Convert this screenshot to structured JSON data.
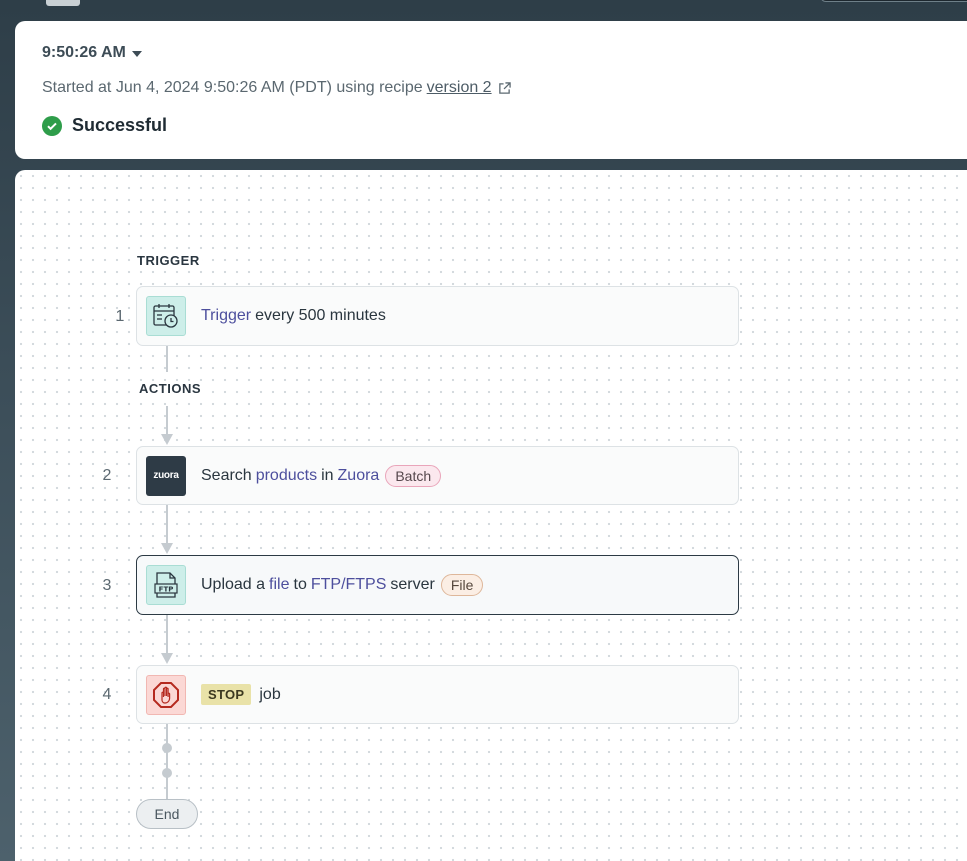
{
  "header": {
    "time": "9:50:26 AM",
    "started_prefix": "Started at Jun 4, 2024 9:50:26 AM (PDT) using recipe",
    "version_link": "version 2",
    "status": "Successful",
    "status_color": "#2e9d4a"
  },
  "flow": {
    "trigger_label": "TRIGGER",
    "actions_label": "ACTIONS",
    "steps": [
      {
        "num": "1",
        "icon": "calendar-clock-icon",
        "parts": {
          "a": "Trigger",
          "b": "every 500 minutes"
        }
      },
      {
        "num": "2",
        "icon": "zuora-logo",
        "logo_text": "zuora",
        "parts": {
          "a": "Search",
          "b": "products",
          "c": "in",
          "d": "Zuora"
        },
        "badge": "Batch"
      },
      {
        "num": "3",
        "icon": "ftp-file-icon",
        "parts": {
          "a": "Upload a",
          "b": "file",
          "c": "to",
          "d": "FTP/FTPS",
          "e": "server"
        },
        "badge": "File",
        "selected": true
      },
      {
        "num": "4",
        "icon": "stop-hand-icon",
        "badge": "STOP",
        "parts": {
          "a": "job"
        }
      }
    ],
    "end_label": "End"
  }
}
